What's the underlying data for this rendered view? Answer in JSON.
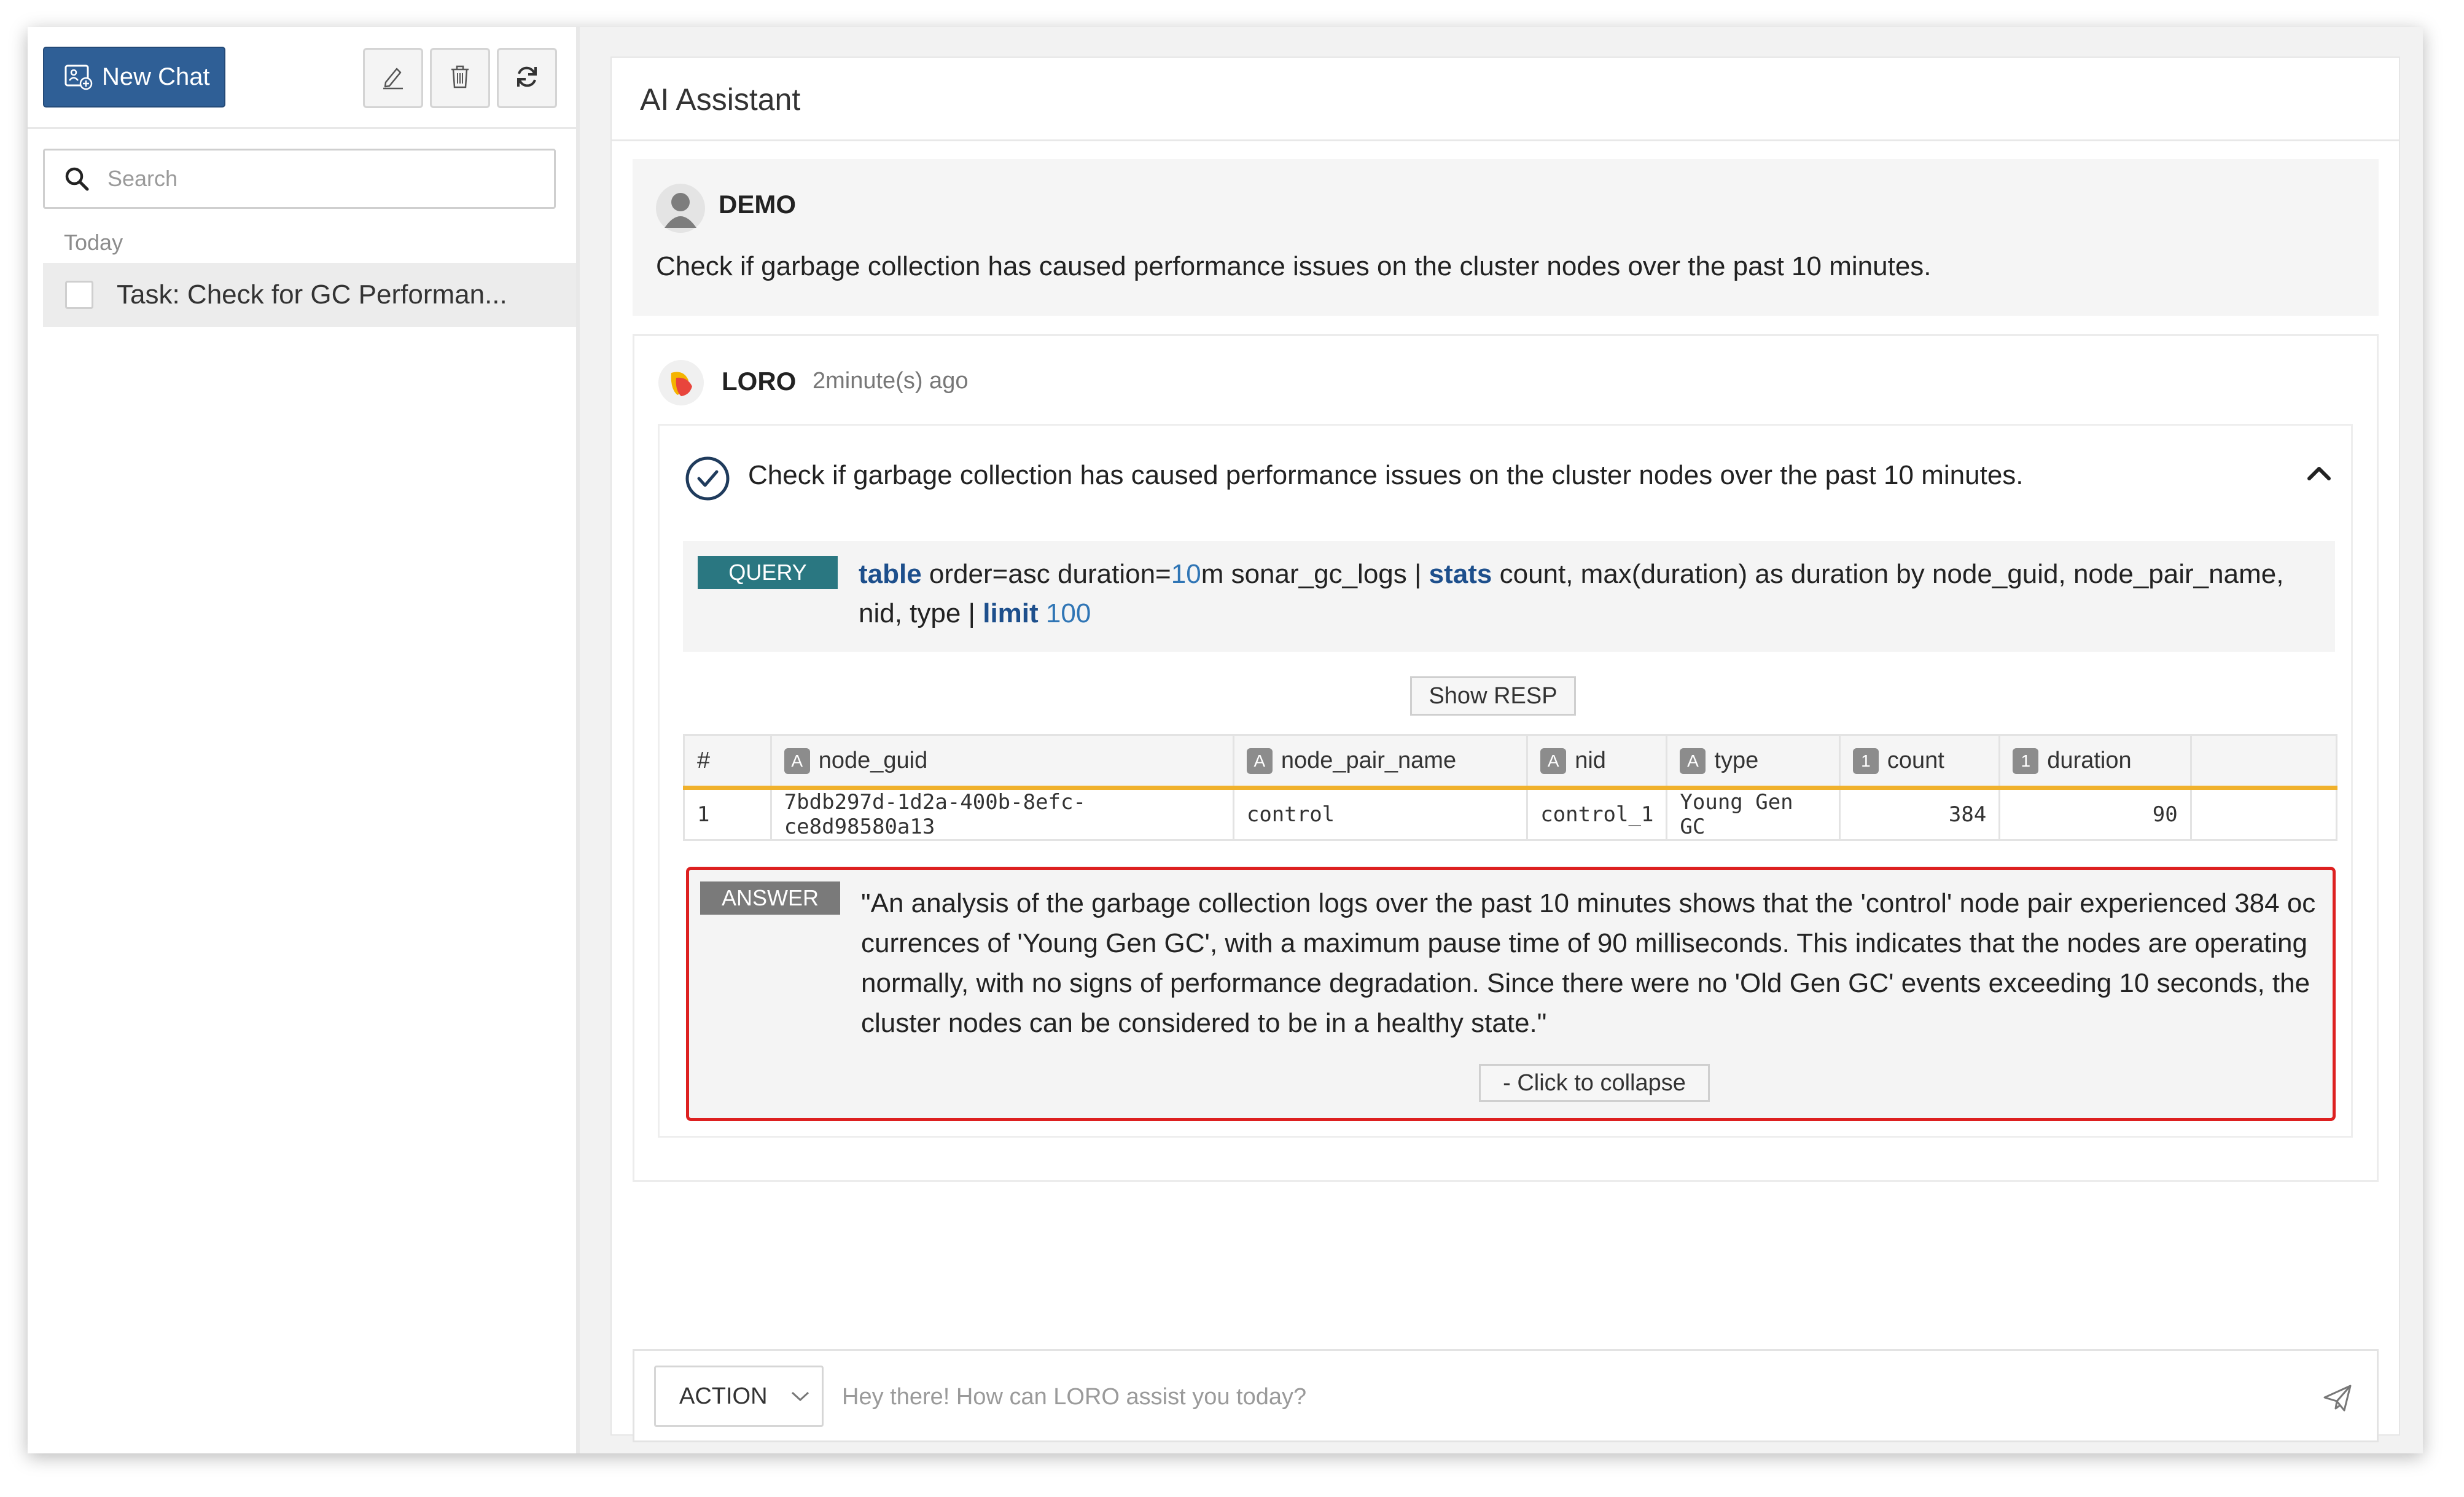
{
  "sidebar": {
    "new_chat_label": "New Chat",
    "search_placeholder": "Search",
    "group_label": "Today",
    "conversations": [
      {
        "label": "Task: Check for GC Performan..."
      }
    ],
    "icons": [
      "new-chat-icon",
      "edit-icon",
      "trash-icon",
      "refresh-icon",
      "search-icon"
    ]
  },
  "main": {
    "title": "AI Assistant",
    "user_message": {
      "name": "DEMO",
      "text": "Check if garbage collection has caused performance issues on the cluster nodes over the past 10 minutes."
    },
    "bot_message": {
      "name": "LORO",
      "time": "2minute(s) ago",
      "task": {
        "text": "Check if garbage collection has caused performance issues on the cluster nodes over the past 10 minutes.",
        "query_badge": "QUERY",
        "query": {
          "kw_table": "table",
          "p1": " order=asc duration=",
          "n_duration": "10",
          "p2": "m sonar_gc_logs | ",
          "kw_stats": "stats",
          "p3": " count, max(duration) as duration by node_guid, node_pair_name, nid, type | ",
          "kw_limit": "limit",
          "p4": " ",
          "n_limit": "100"
        },
        "show_resp_label": "Show RESP",
        "table": {
          "columns": [
            {
              "label": "#",
              "type_badge": ""
            },
            {
              "label": "node_guid",
              "type_badge": "A"
            },
            {
              "label": "node_pair_name",
              "type_badge": "A"
            },
            {
              "label": "nid",
              "type_badge": "A"
            },
            {
              "label": "type",
              "type_badge": "A"
            },
            {
              "label": "count",
              "type_badge": "1"
            },
            {
              "label": "duration",
              "type_badge": "1"
            }
          ],
          "rows": [
            [
              "1",
              "7bdb297d-1d2a-400b-8efc-ce8d98580a13",
              "control",
              "control_1",
              "Young Gen GC",
              "384",
              "90"
            ]
          ]
        },
        "answer_badge": "ANSWER",
        "answer": "\"An analysis of the garbage collection logs over the past 10 minutes shows that the 'control' node pair experienced 384 occurrences of 'Young Gen GC', with a maximum pause time of 90 milliseconds. This indicates that the nodes are operating normally, with no signs of performance degradation. Since there were no 'Old Gen GC' events exceeding 10 seconds, the cluster nodes can be considered to be in a healthy state.\"",
        "collapse_label": "- Click to collapse"
      }
    },
    "input": {
      "action_label": "ACTION",
      "placeholder": "Hey there! How can LORO assist you today?"
    }
  },
  "colors": {
    "primary_button": "#2f5f96",
    "query_badge": "#2a7781",
    "keyword": "#1d4f8c",
    "table_header_accent": "#f0b12c",
    "answer_border": "#dd2020"
  }
}
